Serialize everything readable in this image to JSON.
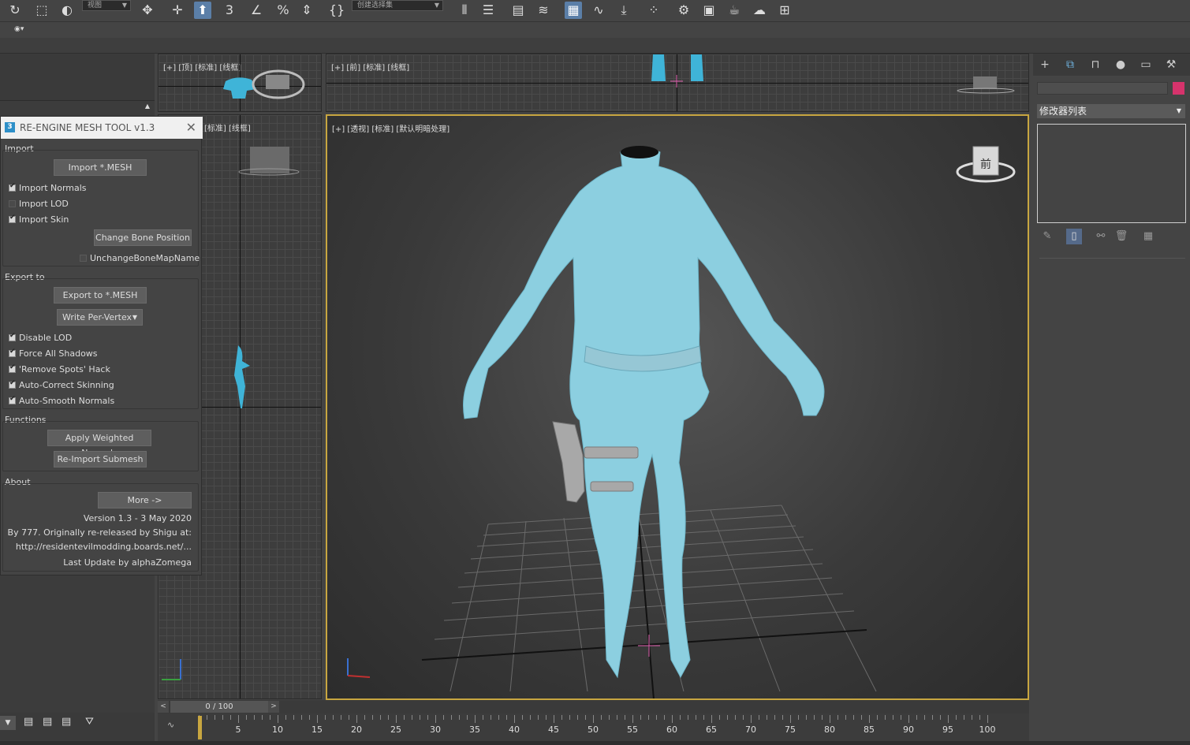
{
  "toolbar": {
    "view_dropdown": "视图",
    "selection_set_dropdown": "创建选择集"
  },
  "viewports": {
    "top": {
      "label": "[+] [顶] [标准] [线框]"
    },
    "front": {
      "label": "[+] [前] [标准] [线框]"
    },
    "left": {
      "label": "[标准] [线框]"
    },
    "perspective": {
      "label": "[+] [透视] [标准] [默认明暗处理]"
    },
    "viewcube_face": "前"
  },
  "tool_window": {
    "title": "RE-ENGINE MESH TOOL v1.3",
    "import": {
      "label": "Import",
      "import_button": "Import *.MESH",
      "import_normals": "Import Normals",
      "import_lod": "Import LOD",
      "import_skin": "Import Skin",
      "change_bone_button": "Change Bone Position",
      "unchange_bone_map": "UnchangeBoneMapName"
    },
    "export": {
      "label": "Export to",
      "export_button": "Export to *.MESH",
      "write_dropdown": "Write Per-Vertex",
      "disable_lod": "Disable LOD",
      "force_shadows": "Force All Shadows",
      "remove_spots": "'Remove Spots' Hack",
      "auto_skinning": "Auto-Correct Skinning",
      "auto_smooth": "Auto-Smooth Normals"
    },
    "functions": {
      "label": "Functions",
      "apply_weighted": "Apply Weighted Normals",
      "reimport_submesh": "Re-Import Submesh"
    },
    "about": {
      "label": "About",
      "more_button": "More ->",
      "version": "Version 1.3 - 3 May 2020",
      "credits": "By 777. Originally re-released by Shigu at:",
      "url": "http://residentevilmodding.boards.net/...",
      "last_update": "Last Update by alphaZomega"
    }
  },
  "command_panel": {
    "modifier_list": "修改器列表",
    "color": "#d6336c"
  },
  "time_slider": {
    "position": "0 / 100",
    "prev": "<",
    "next": ">"
  },
  "track": {
    "ticks": [
      "5",
      "10",
      "15",
      "20",
      "25",
      "30",
      "35",
      "40",
      "45",
      "50",
      "55",
      "60",
      "65",
      "70",
      "75",
      "80",
      "85",
      "90",
      "95",
      "100"
    ]
  }
}
